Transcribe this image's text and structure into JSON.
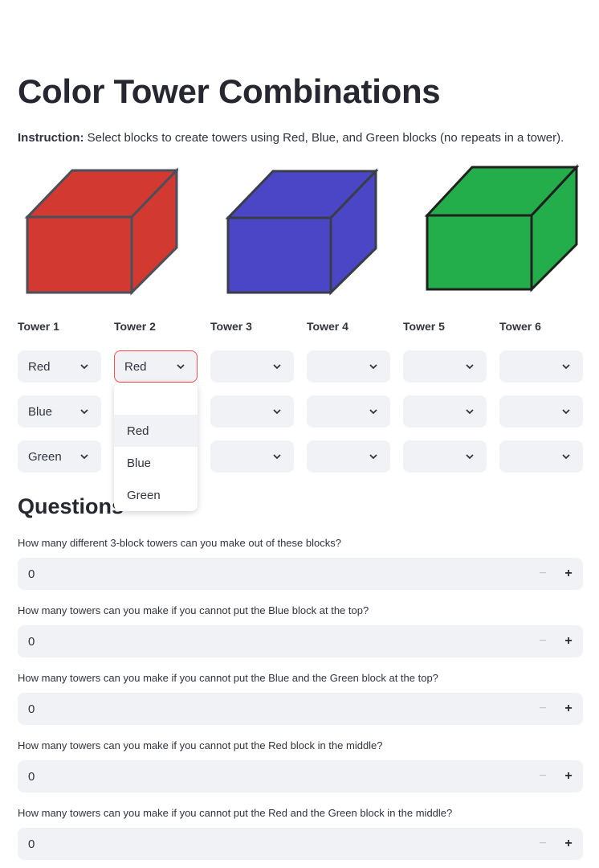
{
  "page": {
    "title": "Color Tower Combinations",
    "instruction_label": "Instruction:",
    "instruction_text": " Select blocks to create towers using Red, Blue, and Green blocks (no repeats in a tower)."
  },
  "colors": {
    "red": "#d23a31",
    "blue": "#4a46c6",
    "green": "#24ae4b",
    "accent": "#ff4b4b",
    "input_bg": "#f0f2f6"
  },
  "cubes": [
    {
      "name": "red-cube",
      "color": "#d23a31"
    },
    {
      "name": "blue-cube",
      "color": "#4a46c6"
    },
    {
      "name": "green-cube",
      "color": "#24ae4b"
    }
  ],
  "towers": {
    "headers": [
      "Tower 1",
      "Tower 2",
      "Tower 3",
      "Tower 4",
      "Tower 5",
      "Tower 6"
    ],
    "rows": [
      [
        "Red",
        "Red",
        "",
        "",
        "",
        ""
      ],
      [
        "Blue",
        "",
        "",
        "",
        "",
        ""
      ],
      [
        "Green",
        "",
        "",
        "",
        "",
        ""
      ]
    ]
  },
  "dropdown": {
    "open_for": "Tower 2 row 1",
    "options": [
      "",
      "Red",
      "Blue",
      "Green"
    ],
    "highlighted": "Red"
  },
  "questions": {
    "title": "Questions",
    "items": [
      {
        "label": "How many different 3-block towers can you make out of these blocks?",
        "value": "0"
      },
      {
        "label": "How many towers can you make if you cannot put the Blue block at the top?",
        "value": "0"
      },
      {
        "label": "How many towers can you make if you cannot put the Blue and the Green block at the top?",
        "value": "0"
      },
      {
        "label": "How many towers can you make if you cannot put the Red block in the middle?",
        "value": "0"
      },
      {
        "label": "How many towers can you make if you cannot put the Red and the Green block in the middle?",
        "value": "0"
      }
    ],
    "minus_symbol": "−",
    "plus_symbol": "+"
  }
}
